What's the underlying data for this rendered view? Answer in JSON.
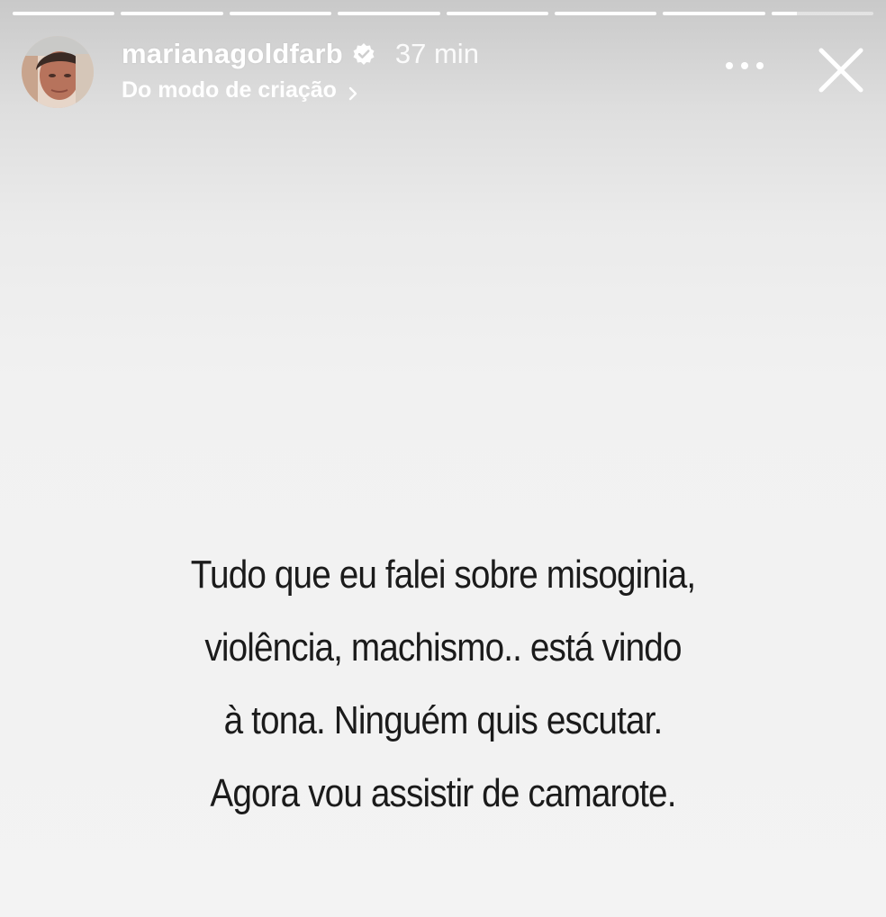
{
  "progress": {
    "segments": [
      1,
      1,
      1,
      1,
      1,
      1,
      1,
      0.25
    ]
  },
  "header": {
    "username": "marianagoldfarb",
    "time": "37 min",
    "subtitle": "Do modo de criação",
    "verified_icon": "verified-badge-icon",
    "chevron_icon": "chevron-right-icon",
    "more_icon": "more-dots-icon",
    "close_icon": "close-icon"
  },
  "story": {
    "lines": [
      "Tudo que eu falei sobre misoginia,",
      "violência, machismo.. está vindo",
      "à tona. Ninguém quis escutar.",
      "Agora vou assistir de camarote."
    ]
  },
  "colors": {
    "text": "#1b1b1b",
    "header_text": "#ffffff",
    "background": "#f3f3f3"
  }
}
